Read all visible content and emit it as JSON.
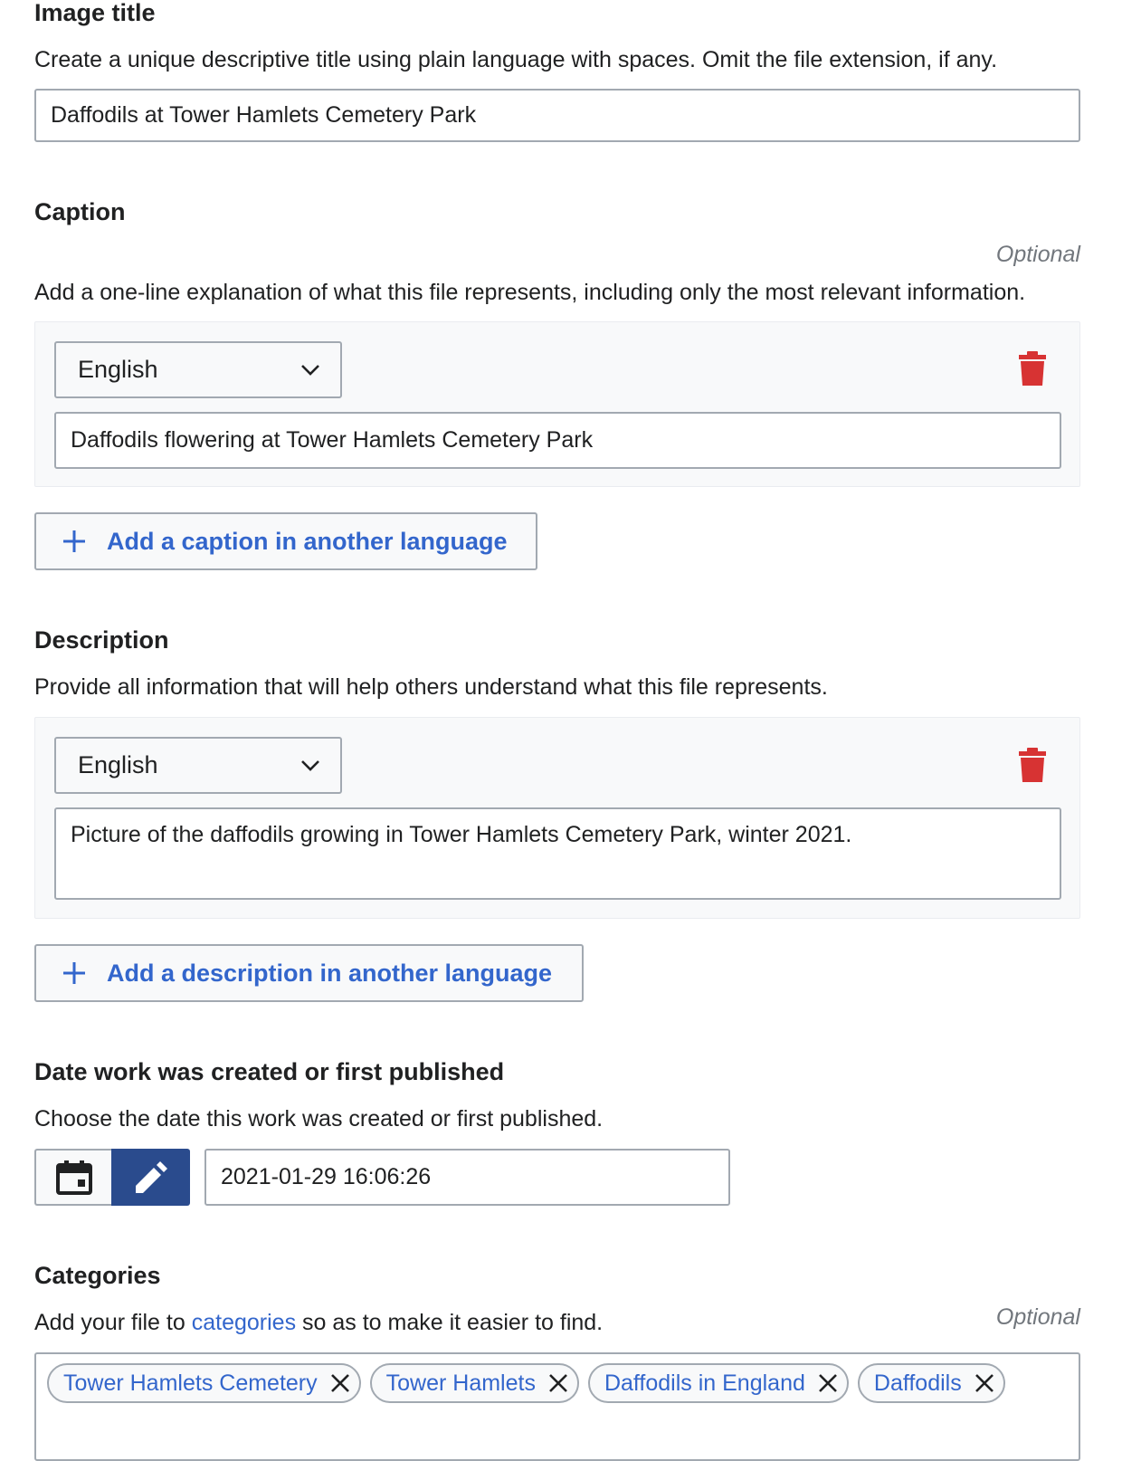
{
  "title_section": {
    "heading": "Image title",
    "help": "Create a unique descriptive title using plain language with spaces. Omit the file extension, if any.",
    "value": "Daffodils at Tower Hamlets Cemetery Park"
  },
  "caption_section": {
    "heading": "Caption",
    "optional": "Optional",
    "help": "Add a one-line explanation of what this file represents, including only the most relevant information.",
    "language": "English",
    "value": "Daffodils flowering at Tower Hamlets Cemetery Park",
    "add_label": "Add a caption in another language"
  },
  "description_section": {
    "heading": "Description",
    "help": "Provide all information that will help others understand what this file represents.",
    "language": "English",
    "value": "Picture of the daffodils growing in Tower Hamlets Cemetery Park, winter 2021.",
    "add_label": "Add a description in another language"
  },
  "date_section": {
    "heading": "Date work was created or first published",
    "help": "Choose the date this work was created or first published.",
    "value": "2021-01-29 16:06:26",
    "calendar_icon": "calendar-icon",
    "edit_icon": "pencil-icon"
  },
  "categories_section": {
    "heading": "Categories",
    "optional": "Optional",
    "help_prefix": "Add your file to ",
    "help_link": "categories",
    "help_suffix": " so as to make it easier to find.",
    "tags": [
      "Tower Hamlets Cemetery",
      "Tower Hamlets",
      "Daffodils in England",
      "Daffodils"
    ]
  },
  "colors": {
    "accent": "#3366cc",
    "delete": "#d73333",
    "date_active": "#2a4b8d",
    "border": "#a2a9b1"
  }
}
